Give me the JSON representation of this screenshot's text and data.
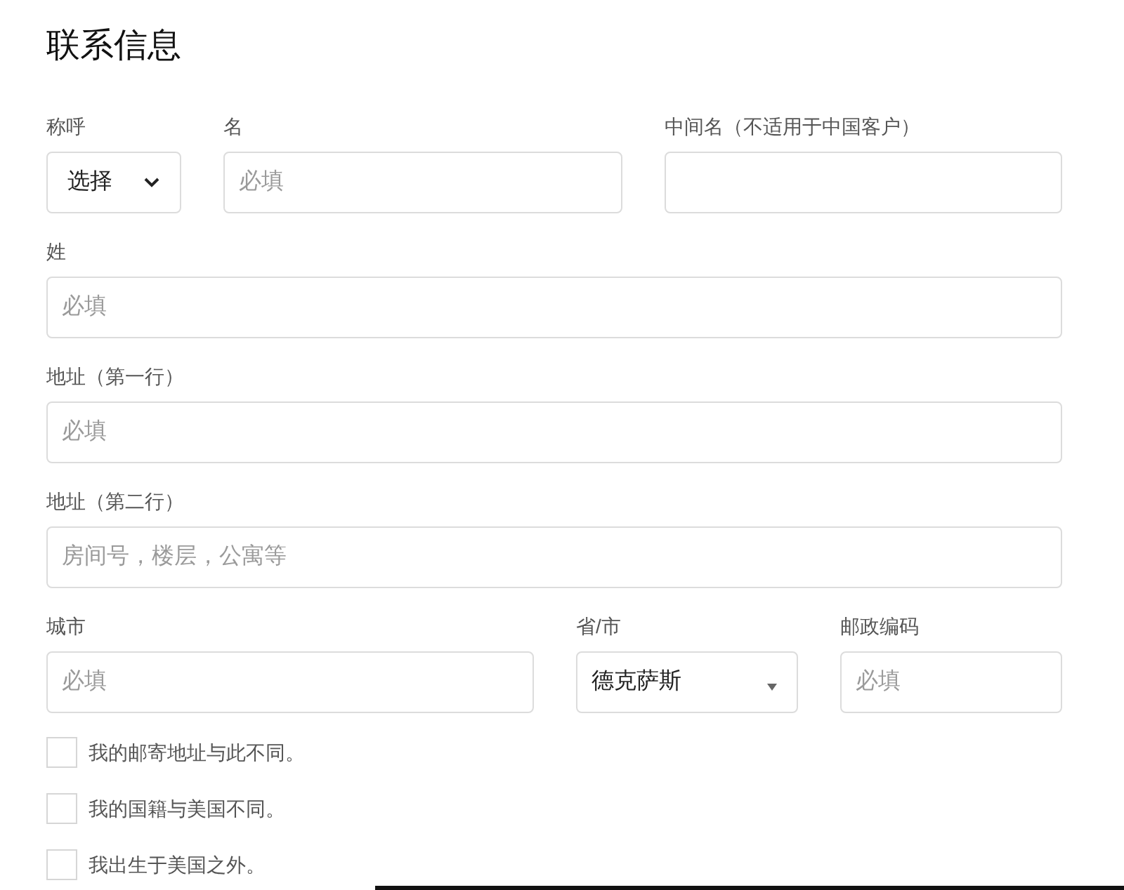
{
  "title": "联系信息",
  "rows": [
    [
      {
        "label": "称呼",
        "kind": "select",
        "value": "选择"
      },
      {
        "label": "名",
        "kind": "input",
        "placeholder": "必填"
      },
      {
        "label": "中间名（不适用于中国客户）",
        "kind": "input"
      }
    ],
    [
      {
        "label": "姓",
        "kind": "input",
        "placeholder": "必填"
      }
    ],
    [
      {
        "label": "地址（第一行）",
        "kind": "input",
        "placeholder": "必填"
      }
    ],
    [
      {
        "label": "地址（第二行）",
        "kind": "input",
        "placeholder": "房间号，楼层，公寓等"
      }
    ],
    [
      {
        "label": "城市",
        "kind": "input",
        "placeholder": "必填"
      },
      {
        "label": "省/市",
        "kind": "dropdown",
        "value": "德克萨斯"
      },
      {
        "label": "邮政编码",
        "kind": "input",
        "placeholder": "必填"
      }
    ]
  ],
  "checkboxes": [
    {
      "label": "我的邮寄地址与此不同。",
      "checked": false
    },
    {
      "label": "我的国籍与美国不同。",
      "checked": false
    },
    {
      "label": "我出生于美国之外。",
      "checked": false
    }
  ]
}
